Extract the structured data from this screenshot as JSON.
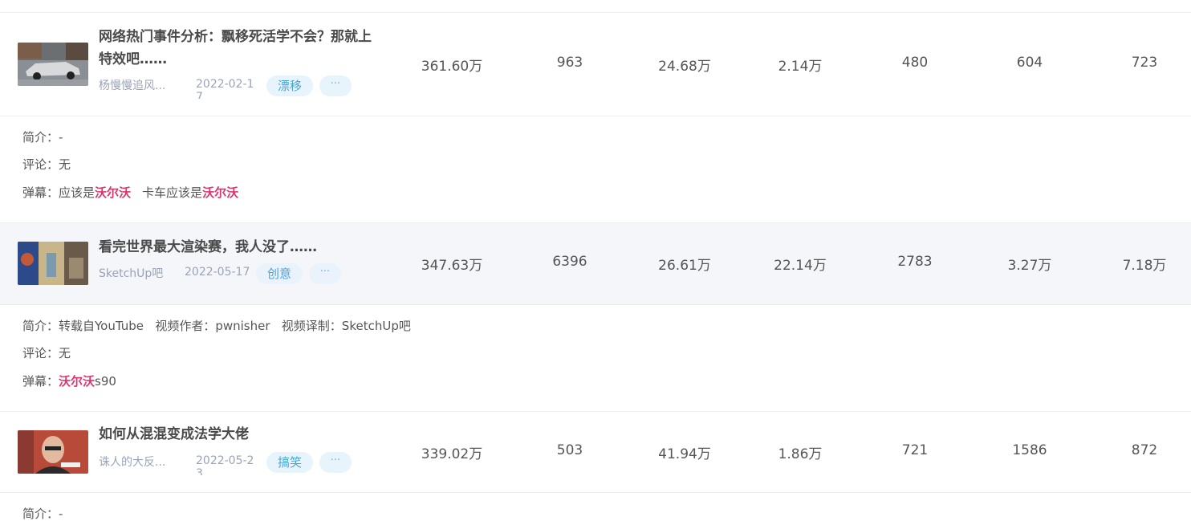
{
  "videos": [
    {
      "title": "网络热门事件分析：飘移死活学不会？那就上特效吧……",
      "author": "杨慢慢追风...",
      "date": "2022-02-17",
      "tag": "漂移",
      "more": "···",
      "stats": [
        "361.60万",
        "963",
        "24.68万",
        "2.14万",
        "480",
        "604",
        "723"
      ],
      "intro_label": "简介：",
      "intro": "-",
      "comment_label": "评论：",
      "comment": "无",
      "danmaku_label": "弹幕：",
      "danmaku": [
        {
          "pre": "应该是",
          "hl": "沃尔沃",
          "post": ""
        },
        {
          "pre": "卡车应该是",
          "hl": "沃尔沃",
          "post": ""
        }
      ]
    },
    {
      "title": "看完世界最大渲染赛，我人没了……",
      "author": "SketchUp吧",
      "date": "2022-05-17",
      "tag": "创意",
      "more": "···",
      "stats": [
        "347.63万",
        "6396",
        "26.61万",
        "22.14万",
        "2783",
        "3.27万",
        "7.18万"
      ],
      "intro_label": "简介：",
      "intro": "转载自YouTube   视频作者：pwnisher   视频译制：SketchUp吧",
      "comment_label": "评论：",
      "comment": "无",
      "danmaku_label": "弹幕：",
      "danmaku": [
        {
          "pre": "",
          "hl": "沃尔沃",
          "post": "s90"
        }
      ]
    },
    {
      "title": "如何从混混变成法学大佬",
      "author": "诛人的大反...",
      "date": "2022-05-23",
      "tag": "搞笑",
      "more": "···",
      "stats": [
        "339.02万",
        "503",
        "41.94万",
        "1.86万",
        "721",
        "1586",
        "872"
      ],
      "intro_label": "简介：",
      "intro": "-"
    }
  ],
  "colors": {
    "highlight": "#e0336c",
    "tag_bg": "#e8f4fc",
    "tag_text": "#4ba3d8"
  },
  "icons": [
    "thumbnail-car",
    "thumbnail-render",
    "thumbnail-person"
  ]
}
